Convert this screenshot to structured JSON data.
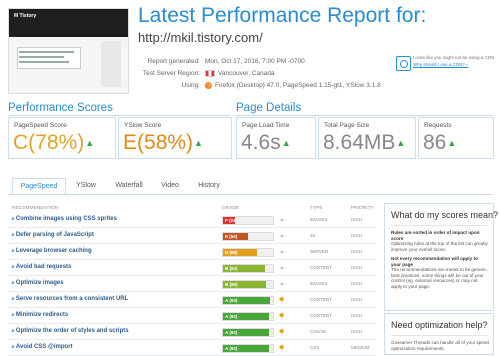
{
  "header": {
    "title": "Latest Performance Report for:",
    "url": "http://mkil.tistory.com/",
    "thumbnail_logo": "M Tistory",
    "meta": [
      {
        "label": "Report generated:",
        "value": "Mon, Oct 17, 2016, 7:00 PM -0700"
      },
      {
        "label": "Test Server Region:",
        "value": "Vancouver, Canada"
      },
      {
        "label": "Using:",
        "value": "Firefox (Desktop) 47.0, PageSpeed 1.15-gt1, YSlow 3.1.8"
      }
    ],
    "con_text1": "Looks like you might not be using a CDN",
    "con_text2": "Why should I use a CDN? »"
  },
  "scores": {
    "section_title": "Performance Scores",
    "pagespeed": {
      "label": "PageSpeed Score",
      "grade": "C",
      "value": "(78%)"
    },
    "yslow": {
      "label": "YSlow Score",
      "grade": "E",
      "value": "(58%)"
    }
  },
  "details": {
    "section_title": "Page Details",
    "load_time": {
      "label": "Page Load Time",
      "value": "4.6s"
    },
    "page_size": {
      "label": "Total Page Size",
      "value": "8.64MB"
    },
    "requests": {
      "label": "Requests",
      "value": "86"
    }
  },
  "tabs": [
    "PageSpeed",
    "YSlow",
    "Waterfall",
    "Video",
    "History"
  ],
  "table": {
    "headers": {
      "rec": "RECOMMENDATION",
      "grade": "GRADE",
      "type": "TYPE",
      "priority": "PRIORITY"
    },
    "rows": [
      {
        "name": "Combine images using CSS sprites",
        "grade": "F (24)",
        "score": 24,
        "color": "#d9312b",
        "dir": "down",
        "type": "IMAGES",
        "priority": "HIGH"
      },
      {
        "name": "Defer parsing of JavaScript",
        "grade": "E (50)",
        "score": 50,
        "color": "#c2581f",
        "dir": "down",
        "type": "JS",
        "priority": "HIGH"
      },
      {
        "name": "Leverage browser caching",
        "grade": "D (68)",
        "score": 68,
        "color": "#e0a020",
        "dir": "down",
        "type": "SERVER",
        "priority": "HIGH"
      },
      {
        "name": "Avoid bad requests",
        "grade": "B (84)",
        "score": 84,
        "color": "#8ab534",
        "dir": "down",
        "type": "CONTENT",
        "priority": "HIGH"
      },
      {
        "name": "Optimize images",
        "grade": "B (86)",
        "score": 86,
        "color": "#8ab534",
        "dir": "down",
        "type": "IMAGES",
        "priority": "HIGH"
      },
      {
        "name": "Serve resources from a consistent URL",
        "grade": "A (93)",
        "score": 93,
        "color": "#4aa63a",
        "dir": "same",
        "type": "CONTENT",
        "priority": "HIGH"
      },
      {
        "name": "Minimize redirects",
        "grade": "A (92)",
        "score": 92,
        "color": "#4aa63a",
        "dir": "same",
        "type": "CONTENT",
        "priority": "HIGH"
      },
      {
        "name": "Optimize the order of styles and scripts",
        "grade": "A (92)",
        "score": 92,
        "color": "#4aa63a",
        "dir": "same",
        "type": "CSS/JS",
        "priority": "HIGH"
      },
      {
        "name": "Avoid CSS @import",
        "grade": "A (92)",
        "score": 92,
        "color": "#4aa63a",
        "dir": "same",
        "type": "CSS",
        "priority": "MEDIUM"
      }
    ]
  },
  "panel1": {
    "title": "What do my scores mean?",
    "p1_bold": "Rules are sorted in order of impact upon score",
    "p1": "Optimizing rules at the top of the list can greatly improve your overall score.",
    "p2_bold": "Not every recommendation will apply to your page",
    "p2": "The recommendations are meant to be generic, best practices; some things will be out of your control (eg. external resources) or may not apply to your page."
  },
  "panel2": {
    "title": "Need optimization help?",
    "p1": "Gossamer Threads can handle all of your speed optimization requirements."
  },
  "colors": {
    "accent": "#2a8cd0",
    "grade_c": "#e3a22a",
    "grade_e": "#e08a16"
  }
}
